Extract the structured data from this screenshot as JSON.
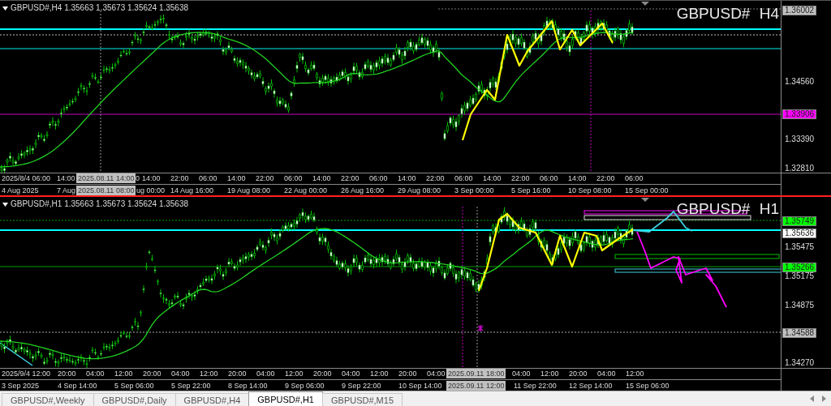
{
  "panels": [
    {
      "header": "GBPUSD#,H4 1.35663 1.35673 1.35624 1.35638",
      "title": "GBPUSD# H4",
      "active": false,
      "price_labels": [
        {
          "text": "1.36002",
          "kind": "tag",
          "color": "#c0c0c0"
        },
        {
          "text": "1.34560",
          "kind": "plain"
        },
        {
          "text": "1.33906",
          "kind": "tag",
          "color": "#ff00ff"
        },
        {
          "text": "1.33390",
          "kind": "plain"
        },
        {
          "text": "1.32810",
          "kind": "plain"
        }
      ],
      "time_axis": {
        "row_1": [
          "2025/8/4 06:00",
          "14:00",
          "0",
          "14:00",
          "22:00",
          "06:00",
          "14:00",
          "22:00",
          "06:00",
          "14:00",
          "22:00",
          "06:00",
          "14:00",
          "22:00",
          "06:00",
          "14:00",
          "22:00",
          "06:00",
          "14:00",
          "22:00",
          "06:00"
        ],
        "row_2": [
          "4 Aug 2025",
          "7 Aug",
          "ug 00:00",
          "14 Aug 16:00",
          "19 Aug 08:00",
          "22 Aug 00:00",
          "26 Aug 16:00",
          "29 Aug 08:00",
          "3 Sep 00:00",
          "5 Sep 16:00",
          "10 Sep 08:00",
          "15 Sep 00:00"
        ],
        "crosshair_labels": [
          "2025.08.11 14:00",
          "2025.08.11 08:00"
        ]
      }
    },
    {
      "header": "GBPUSD#,H1 1.35663 1.35673 1.35624 1.35638",
      "title": "GBPUSD# H1",
      "active": true,
      "price_labels": [
        {
          "text": "1.35749",
          "kind": "tag",
          "color": "#00ff00"
        },
        {
          "text": "1.35636",
          "kind": "tag",
          "color": "#ffffff"
        },
        {
          "text": "1.35475",
          "kind": "plain"
        },
        {
          "text": "1.35266",
          "kind": "tag",
          "color": "#00ff00"
        },
        {
          "text": "1.35175",
          "kind": "plain"
        },
        {
          "text": "1.34875",
          "kind": "plain"
        },
        {
          "text": "1.34588",
          "kind": "tag",
          "color": "#c0c0c0"
        },
        {
          "text": "1.34270",
          "kind": "plain"
        }
      ],
      "time_axis": {
        "row_1": [
          "2025/9/4 12:00",
          "20:00",
          "04:00",
          "12:00",
          "20:00",
          "04:00",
          "12:00",
          "20:00",
          "04:00",
          "12:00",
          "20:00",
          "04:00",
          "12:00",
          "20:00",
          "04:00",
          "04:00",
          "12:00",
          "20:00",
          "04:00",
          "12:00"
        ],
        "row_2": [
          "3 Sep 2025",
          "4 Sep 14:00",
          "5 Sep 06:00",
          "5 Sep 22:00",
          "8 Sep 14:00",
          "9 Sep 06:00",
          "9 Sep 22:00",
          "10 Sep 14:00",
          "11 Sep 22:00",
          "12 Sep 14:00",
          "15 Sep 06:00"
        ],
        "crosshair_labels": [
          "2025.09.11 18:00",
          "2025.09.11 12:00"
        ]
      }
    }
  ],
  "tabs": [
    {
      "label": "GBPUSD#,Weekly",
      "selected": false
    },
    {
      "label": "GBPUSD#,Daily",
      "selected": false
    },
    {
      "label": "GBPUSD#,H4",
      "selected": false
    },
    {
      "label": "GBPUSD#,H1",
      "selected": true
    },
    {
      "label": "GBPUSD#,M15",
      "selected": false
    }
  ]
}
